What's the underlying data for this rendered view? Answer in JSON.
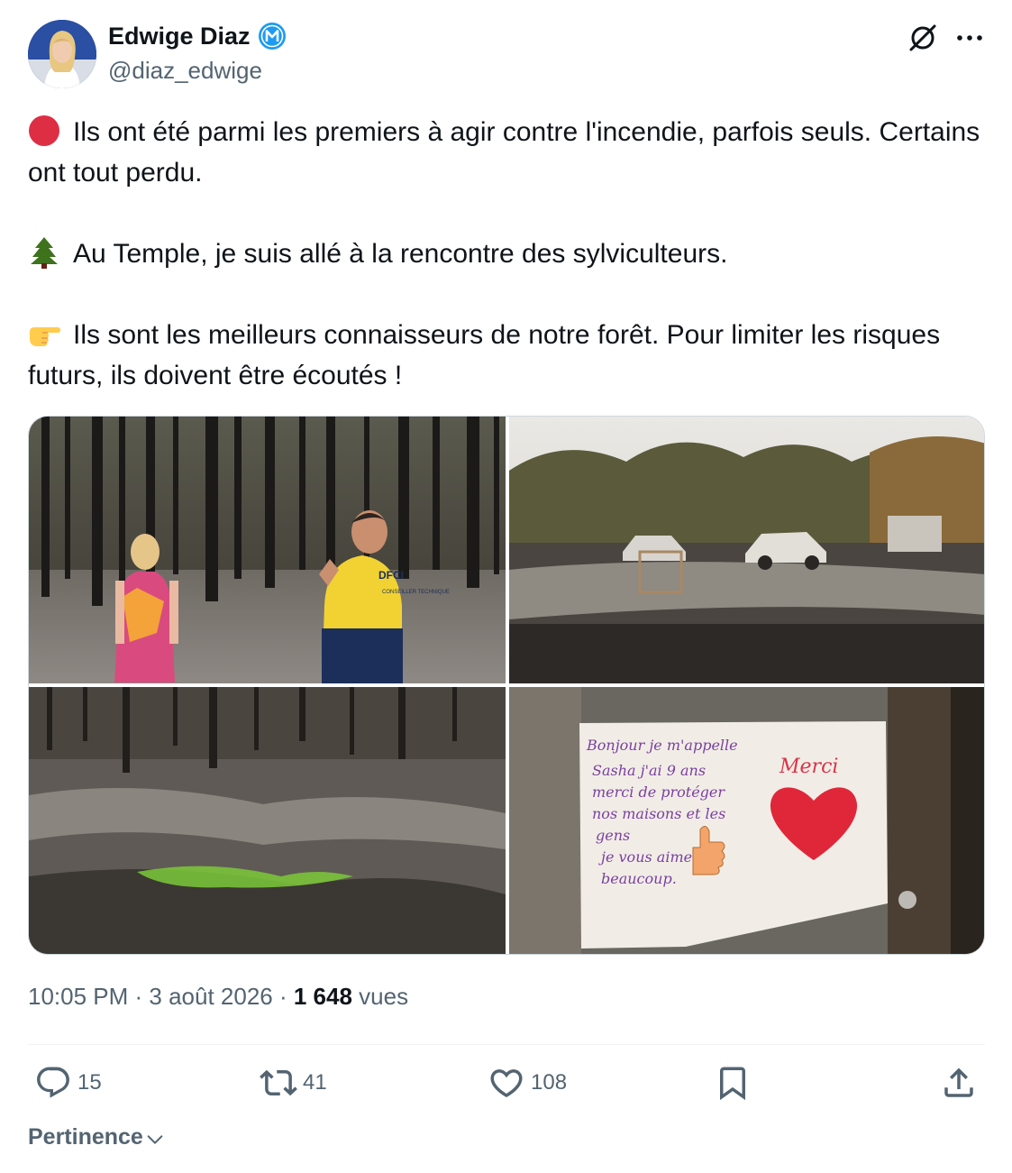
{
  "author": {
    "name": "Edwige Diaz",
    "handle": "@diaz_edwige",
    "verified_badge_icon": "verified-m-badge-icon",
    "badge_color": "#1d9bf0"
  },
  "header_icons": [
    "grok-icon",
    "more-icon"
  ],
  "tweet": {
    "paragraphs": [
      {
        "emoji": "red-circle-icon",
        "text": "Ils ont été parmi les premiers à agir contre l'incendie, parfois seuls. Certains ont tout perdu."
      },
      {
        "emoji": "evergreen-tree-icon",
        "text": "Au Temple, je suis allé à la rencontre des sylviculteurs."
      },
      {
        "emoji": "pointing-hand-icon",
        "text": "Ils sont les meilleurs connaisseurs de notre forêt. Pour limiter les risques futurs, ils doivent être écoutés !"
      }
    ]
  },
  "media": {
    "images": [
      {
        "name": "burned-forest-two-people",
        "badge_text": "DFCI",
        "jacket_text": "CONSEILLER TECHNIQUE"
      },
      {
        "name": "burned-property-cars"
      },
      {
        "name": "burned-forest-floor-regrowth"
      },
      {
        "name": "child-thank-you-note",
        "note_text": "Bonjour je m'appelle Sasha j'ai 9 ans merci de protéger nos maisons et les gens je vous aime beaucoup.",
        "merci": "Merci"
      }
    ]
  },
  "meta": {
    "time": "10:05 PM",
    "sep1": " · ",
    "date": "3 août 2026",
    "sep2": " · ",
    "views_count": "1 648",
    "views_label": " vues"
  },
  "actions": {
    "reply": {
      "icon": "reply-icon",
      "count": "15"
    },
    "retweet": {
      "icon": "retweet-icon",
      "count": "41"
    },
    "like": {
      "icon": "heart-icon",
      "count": "108"
    },
    "bookmark": {
      "icon": "bookmark-icon"
    },
    "share": {
      "icon": "share-icon"
    }
  },
  "sort": {
    "label": "Pertinence",
    "icon": "chevron-down-icon"
  }
}
